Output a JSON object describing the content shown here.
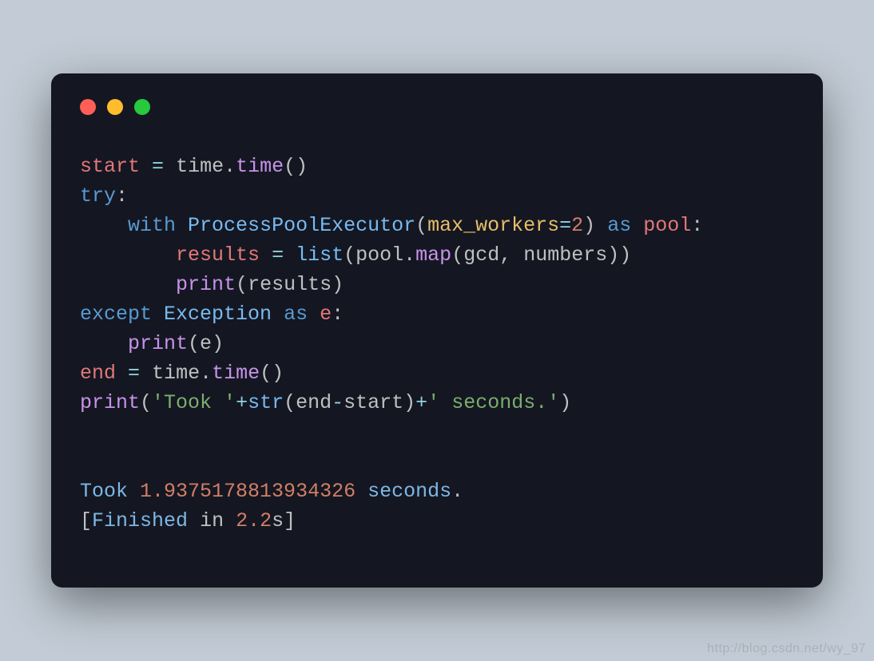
{
  "traffic": {
    "red": "#ff5f56",
    "yellow": "#ffbd2e",
    "green": "#27c93f"
  },
  "code": {
    "l1": {
      "var": "start",
      "sp1": " ",
      "eq": "=",
      "sp2": " ",
      "obj": "time",
      "dot": ".",
      "call": "time",
      "lp": "(",
      "rp": ")"
    },
    "l2": {
      "kw": "try",
      "colon": ":"
    },
    "l3": {
      "indent": "    ",
      "kw": "with",
      "sp": " ",
      "type": "ProcessPoolExecutor",
      "lp": "(",
      "param": "max_workers",
      "eq": "=",
      "num": "2",
      "rp": ")",
      "sp2": " ",
      "as": "as",
      "sp3": " ",
      "var": "pool",
      "colon": ":"
    },
    "l4": {
      "indent": "        ",
      "var": "results",
      "sp1": " ",
      "eq": "=",
      "sp2": " ",
      "fn": "list",
      "lp": "(",
      "obj": "pool",
      "dot": ".",
      "map": "map",
      "lp2": "(",
      "a1": "gcd",
      "comma": ",",
      "sp3": " ",
      "a2": "numbers",
      "rp2": ")",
      "rp": ")"
    },
    "l5": {
      "indent": "        ",
      "fn": "print",
      "lp": "(",
      "arg": "results",
      "rp": ")"
    },
    "l6": {
      "kw": "except",
      "sp": " ",
      "type": "Exception",
      "sp2": " ",
      "as": "as",
      "sp3": " ",
      "var": "e",
      "colon": ":"
    },
    "l7": {
      "indent": "    ",
      "fn": "print",
      "lp": "(",
      "arg": "e",
      "rp": ")"
    },
    "l8": {
      "var": "end",
      "sp1": " ",
      "eq": "=",
      "sp2": " ",
      "obj": "time",
      "dot": ".",
      "call": "time",
      "lp": "(",
      "rp": ")"
    },
    "l9": {
      "fn": "print",
      "lp": "(",
      "s1": "'Took '",
      "plus1": "+",
      "str": "str",
      "lp2": "(",
      "a": "end",
      "minus": "-",
      "b": "start",
      "rp2": ")",
      "plus2": "+",
      "s2": "' seconds.'",
      "rp": ")"
    },
    "out1": {
      "a": "Took",
      "sp": " ",
      "b": "1.9375178813934326",
      "sp2": " ",
      "c": "seconds",
      "d": "."
    },
    "out2": {
      "lb": "[",
      "a": "Finished",
      "sp": " ",
      "b": "in",
      "sp2": " ",
      "c": "2.2",
      "d": "s",
      "rb": "]"
    }
  },
  "watermark": "http://blog.csdn.net/wy_97"
}
